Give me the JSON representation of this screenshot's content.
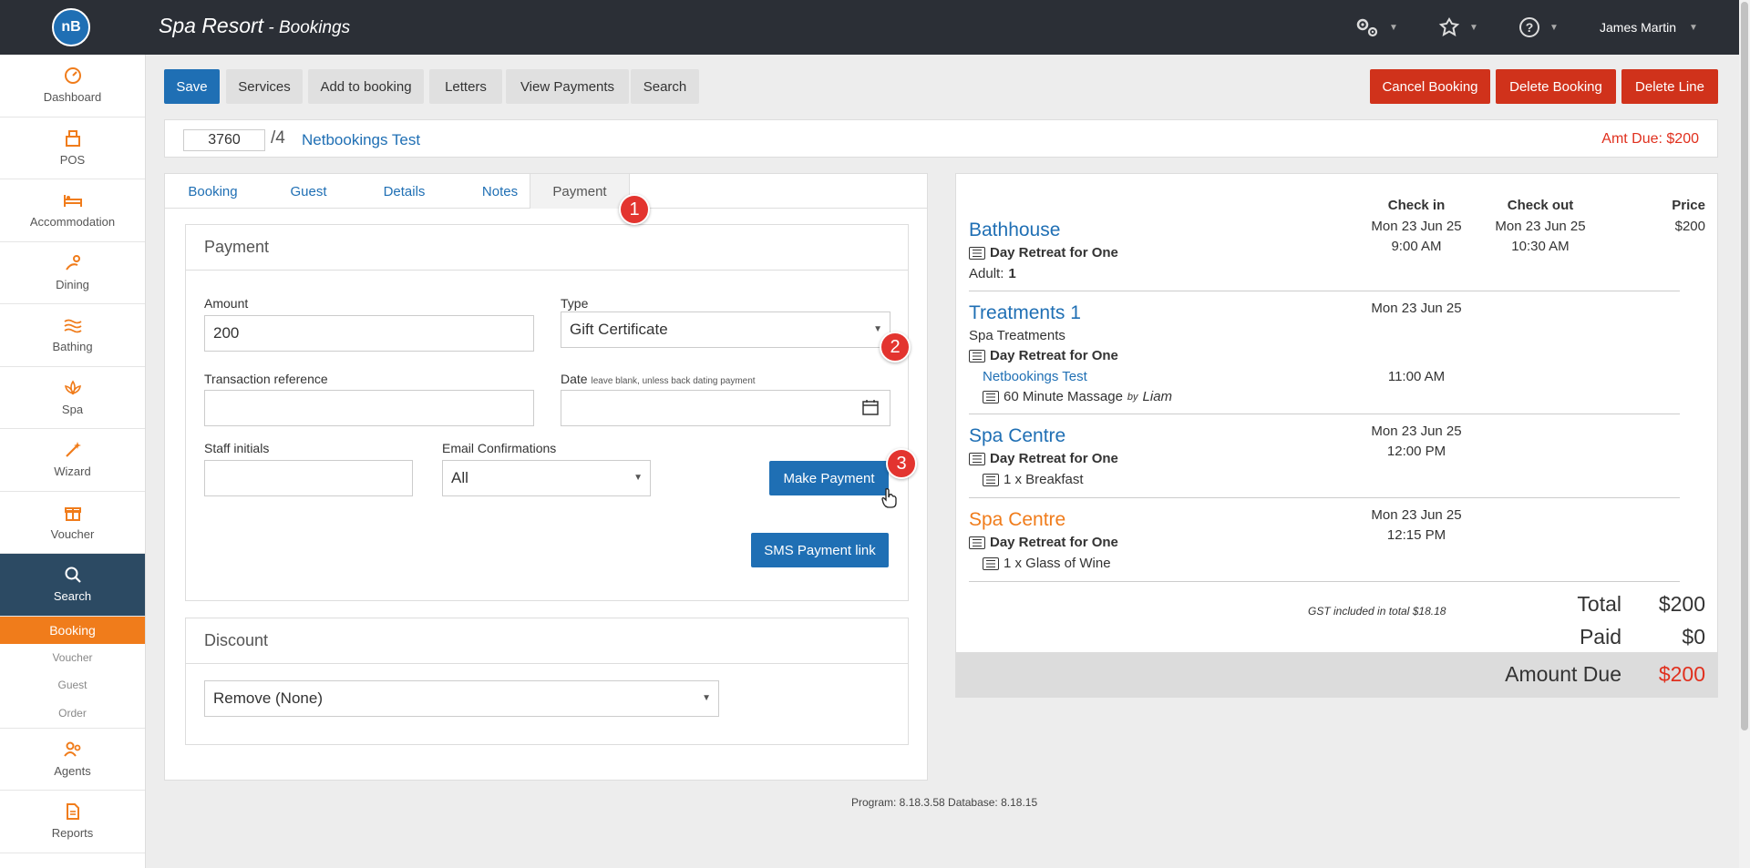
{
  "app": {
    "logo_text": "nB",
    "title": "Spa Resort",
    "separator": " - ",
    "subtitle": "Bookings"
  },
  "topbar": {
    "settings_icon": "gears-icon",
    "tools_icon": "tools-icon",
    "help_icon": "help-icon",
    "user_name": "James Martin"
  },
  "sidebar": {
    "items": [
      {
        "label": "Dashboard",
        "icon": "dashboard-icon"
      },
      {
        "label": "POS",
        "icon": "pos-icon"
      },
      {
        "label": "Accommodation",
        "icon": "bed-icon"
      },
      {
        "label": "Dining",
        "icon": "dining-icon"
      },
      {
        "label": "Bathing",
        "icon": "waves-icon"
      },
      {
        "label": "Spa",
        "icon": "lotus-icon"
      },
      {
        "label": "Wizard",
        "icon": "wand-icon"
      },
      {
        "label": "Voucher",
        "icon": "gift-icon"
      },
      {
        "label": "Search",
        "icon": "search-icon"
      },
      {
        "label": "Agents",
        "icon": "agents-icon"
      },
      {
        "label": "Reports",
        "icon": "report-icon"
      }
    ],
    "search_sub": [
      "Booking",
      "Voucher",
      "Guest",
      "Order"
    ]
  },
  "toolbar": {
    "save": "Save",
    "services": "Services",
    "add_to_booking": "Add to booking",
    "letters": "Letters",
    "view_payments": "View Payments",
    "search": "Search",
    "cancel_booking": "Cancel Booking",
    "delete_booking": "Delete Booking",
    "delete_line": "Delete Line"
  },
  "booking": {
    "number": "3760",
    "suffix": "/4",
    "guest_name": "Netbookings Test",
    "amount_due": "Amt Due: $200"
  },
  "tabs": [
    "Booking",
    "Guest",
    "Details",
    "Notes",
    "Payment"
  ],
  "active_tab": "Payment",
  "badges": [
    "1",
    "2",
    "3"
  ],
  "payment": {
    "title": "Payment",
    "amount_label": "Amount",
    "amount_value": "200",
    "type_label": "Type",
    "type_value": "Gift Certificate",
    "txn_label": "Transaction reference",
    "txn_value": "",
    "date_label": "Date",
    "date_hint": "leave blank, unless back dating payment",
    "date_value": "",
    "staff_label": "Staff initials",
    "staff_value": "",
    "email_label": "Email Confirmations",
    "email_value": "All",
    "make_payment": "Make Payment",
    "sms_link": "SMS Payment link"
  },
  "discount": {
    "title": "Discount",
    "value": "Remove (None)"
  },
  "summary": {
    "headers": {
      "check_in": "Check in",
      "check_out": "Check out",
      "price": "Price"
    },
    "items": [
      {
        "name": "Bathhouse",
        "package": "Day Retreat for One",
        "adult_label": "Adult:",
        "adult_count": "1",
        "check_in_date": "Mon 23 Jun 25",
        "check_in_time": "9:00 AM",
        "check_out_date": "Mon 23 Jun 25",
        "check_out_time": "10:30 AM",
        "price": "$200"
      },
      {
        "name": "Treatments 1",
        "category": "Spa Treatments",
        "package": "Day Retreat for One",
        "guest": "Netbookings Test",
        "treatment": "60 Minute Massage",
        "by_label": "by",
        "therapist": "Liam",
        "check_in_date": "Mon 23 Jun 25",
        "check_in_time": "11:00 AM"
      },
      {
        "name": "Spa Centre",
        "package": "Day Retreat for One",
        "extra": "1 x Breakfast",
        "check_in_date": "Mon 23 Jun 25",
        "check_in_time": "12:00 PM"
      },
      {
        "name": "Spa Centre",
        "package": "Day Retreat for One",
        "extra": "1 x Glass of Wine",
        "check_in_date": "Mon 23 Jun 25",
        "check_in_time": "12:15 PM"
      }
    ],
    "gst_note": "GST included in total $18.18",
    "total_label": "Total",
    "total_value": "$200",
    "paid_label": "Paid",
    "paid_value": "$0",
    "amount_due_label": "Amount Due",
    "amount_due_value": "$200"
  },
  "footer": "Program: 8.18.3.58 Database: 8.18.15",
  "colors": {
    "primary": "#1f6fb4",
    "danger": "#d0321b",
    "accent": "#f07c1b",
    "nav_dark": "#2c4a63",
    "badge": "#e3342f"
  }
}
